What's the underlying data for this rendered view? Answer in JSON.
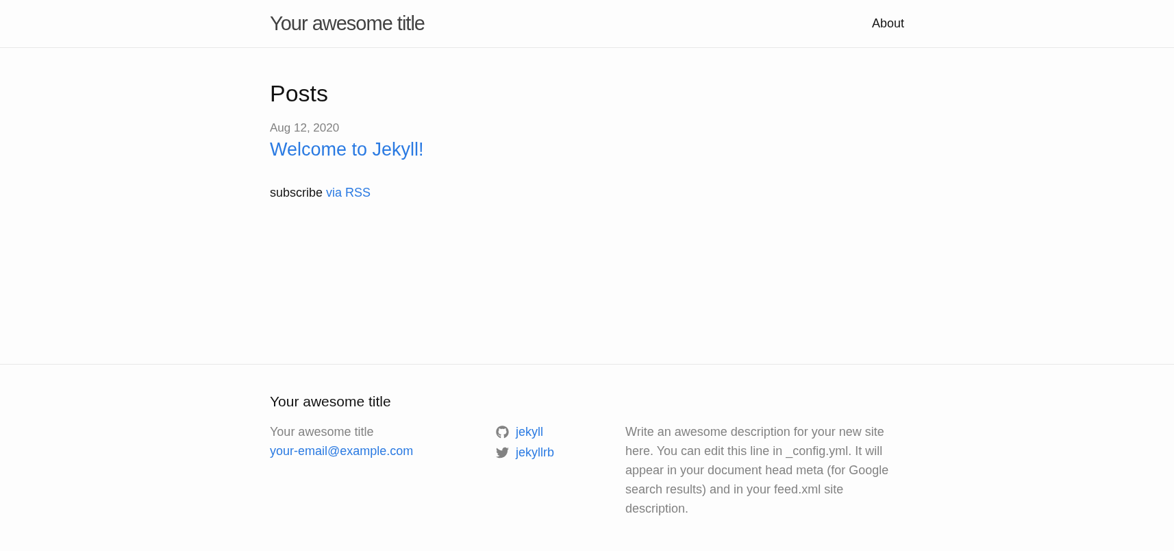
{
  "header": {
    "site_title": "Your awesome title",
    "nav": [
      {
        "label": "About"
      }
    ]
  },
  "main": {
    "heading": "Posts",
    "posts": [
      {
        "date": "Aug 12, 2020",
        "title": "Welcome to Jekyll!"
      }
    ],
    "subscribe": {
      "text": "subscribe",
      "link": "via RSS"
    }
  },
  "footer": {
    "title": "Your awesome title",
    "contact": {
      "name": "Your awesome title",
      "email": "your-email@example.com"
    },
    "social": [
      {
        "kind": "github",
        "label": "jekyll"
      },
      {
        "kind": "twitter",
        "label": "jekyllrb"
      }
    ],
    "description": "Write an awesome description for your new site here. You can edit this line in _config.yml. It will appear in your document head meta (for Google search results) and in your feed.xml site description."
  }
}
